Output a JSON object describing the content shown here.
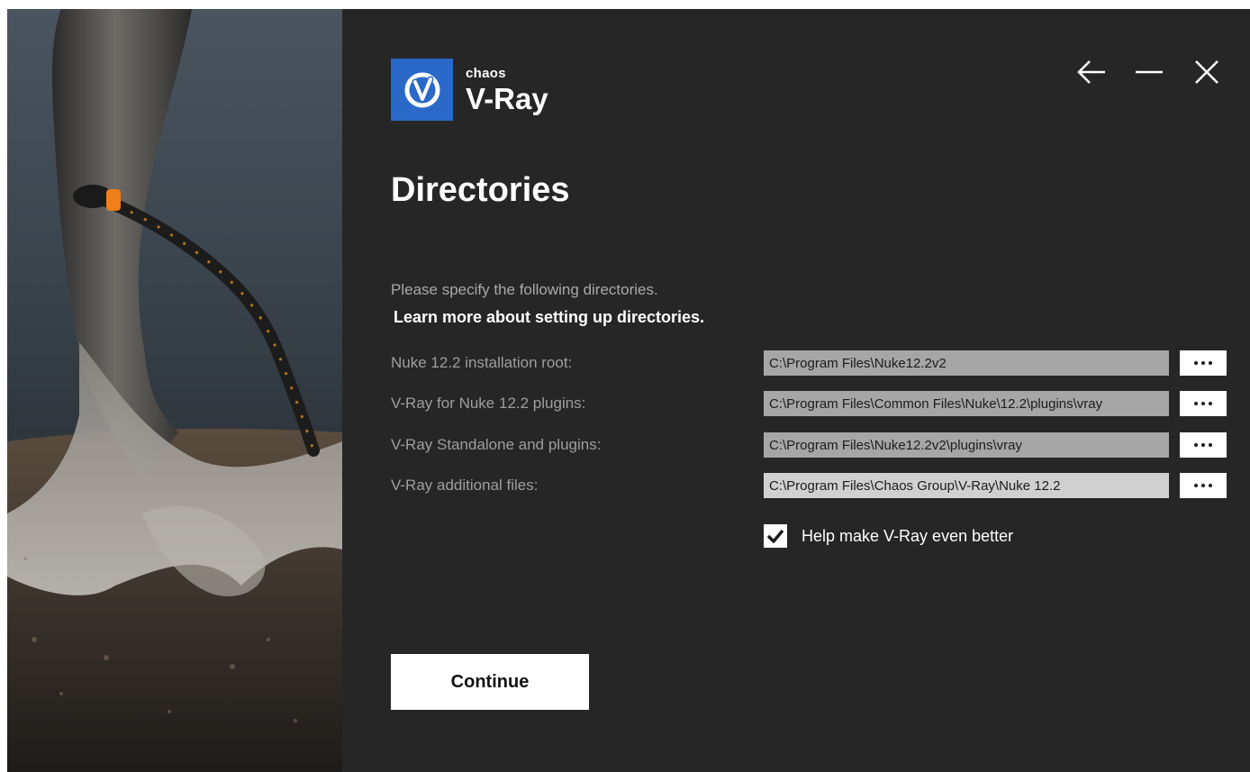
{
  "app": {
    "brand": "chaos",
    "product": "V-Ray",
    "accent_color": "#2a69c7",
    "background_color": "#262626"
  },
  "window_controls": [
    {
      "name": "back",
      "icon": "arrow-left-icon"
    },
    {
      "name": "minimize",
      "icon": "minimize-icon"
    },
    {
      "name": "close",
      "icon": "close-icon"
    }
  ],
  "page": {
    "title": "Directories",
    "description": "Please specify the following directories.",
    "learn_more": "Learn more about setting up directories."
  },
  "directories": [
    {
      "label": "Nuke 12.2 installation root:",
      "value": "C:\\Program Files\\Nuke12.2v2"
    },
    {
      "label": "V-Ray for Nuke 12.2 plugins:",
      "value": "C:\\Program Files\\Common Files\\Nuke\\12.2\\plugins\\vray"
    },
    {
      "label": "V-Ray Standalone and plugins:",
      "value": "C:\\Program Files\\Nuke12.2v2\\plugins\\vray"
    },
    {
      "label": "V-Ray additional files:",
      "value": "C:\\Program Files\\Chaos Group\\V-Ray\\Nuke 12.2"
    }
  ],
  "help_checkbox": {
    "label": "Help make V-Ray even better",
    "checked": true
  },
  "continue_button": "Continue"
}
